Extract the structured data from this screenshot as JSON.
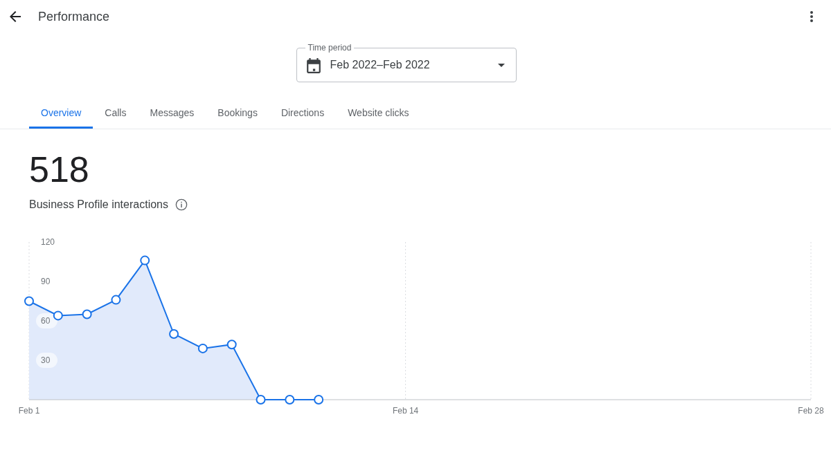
{
  "header": {
    "title": "Performance"
  },
  "time_period": {
    "label": "Time period",
    "value": "Feb 2022–Feb 2022"
  },
  "tabs": [
    {
      "label": "Overview",
      "selected": true
    },
    {
      "label": "Calls",
      "selected": false
    },
    {
      "label": "Messages",
      "selected": false
    },
    {
      "label": "Bookings",
      "selected": false
    },
    {
      "label": "Directions",
      "selected": false
    },
    {
      "label": "Website clicks",
      "selected": false
    }
  ],
  "metric": {
    "value": "518",
    "label": "Business Profile interactions"
  },
  "chart_data": {
    "type": "area",
    "categories": [
      "Feb 1",
      null,
      null,
      null,
      null,
      null,
      null,
      null,
      null,
      null,
      null,
      null,
      null,
      "Feb 14",
      null,
      null,
      null,
      null,
      null,
      null,
      null,
      null,
      null,
      null,
      null,
      null,
      null,
      "Feb 28"
    ],
    "series": [
      {
        "color": "#1a73e8",
        "values": [
          75,
          64,
          65,
          76,
          106,
          50,
          39,
          42,
          0,
          0,
          0,
          null,
          null,
          null,
          null,
          null,
          null,
          null,
          null,
          null,
          null,
          null,
          null,
          null,
          null,
          null,
          null,
          null
        ]
      }
    ],
    "ylim": [
      0,
      120
    ],
    "yticks": [
      30,
      60,
      90,
      120
    ]
  }
}
